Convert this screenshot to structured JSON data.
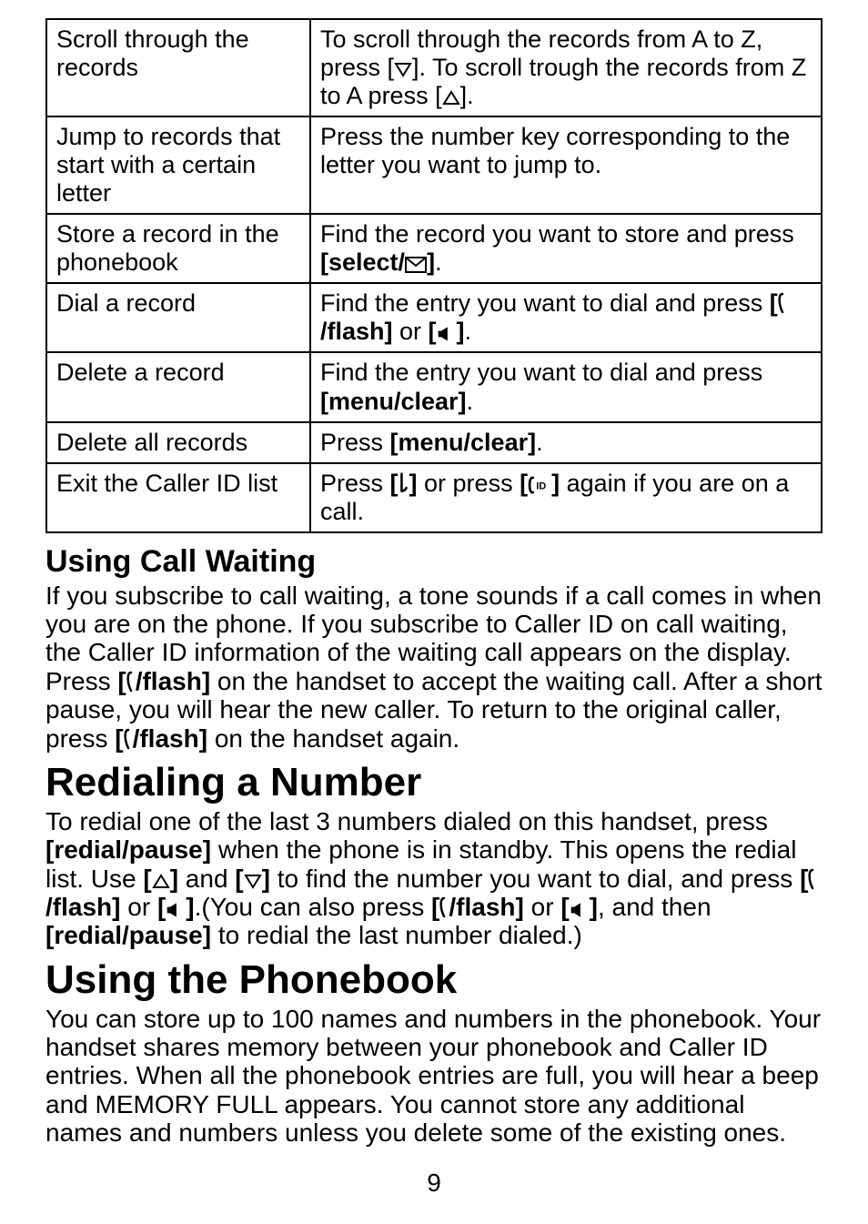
{
  "table": {
    "rows": [
      {
        "left": "Scroll through the records",
        "right_before_icon1": "To scroll through the records from A to Z, press [",
        "right_between": "]. To scroll trough the records from Z to A press [",
        "right_after": "]."
      },
      {
        "left": "Jump to records that start with a certain letter",
        "right": "Press the number key corresponding to the letter you want to jump to."
      },
      {
        "left": "Store a record in the phonebook",
        "right_before": "Find the record you want to store and press ",
        "right_bold_before_icon": "[select/",
        "right_bold_after_icon": "]",
        "right_after": "."
      },
      {
        "left": "Dial a record",
        "right_before": "Find the entry you want to dial and press ",
        "right_bold1_before": "[",
        "right_bold1_after": "/flash]",
        "right_mid": " or ",
        "right_bold2_before": "[",
        "right_bold2_after": "]",
        "right_after": "."
      },
      {
        "left": "Delete a record",
        "right_before": "Find the entry you want to dial and press ",
        "right_bold": "[menu/clear]",
        "right_after": "."
      },
      {
        "left": "Delete all records",
        "right_before": "Press ",
        "right_bold": "[menu/clear]",
        "right_after": "."
      },
      {
        "left": "Exit the Caller ID list",
        "right_before": "Press ",
        "right_bold1_before": "[",
        "right_bold1_after": "]",
        "right_mid": " or press ",
        "right_bold2_before": "[",
        "right_bold2_after": "]",
        "right_after": " again if you are on a call."
      }
    ]
  },
  "sections": {
    "call_waiting": {
      "heading": "Using Call Waiting",
      "p1a": "If you subscribe to call waiting, a tone sounds if a call comes in when you are on the phone. If you subscribe to Caller ID on call waiting, the Caller ID information of the waiting call appears on the display. Press ",
      "p1b_bold_before": "[",
      "p1b_bold_after": "/flash]",
      "p1c": " on the handset to accept the waiting call. After a short pause, you will hear the new caller. To return to the original caller, press ",
      "p1d_bold_before": "[",
      "p1d_bold_after": "/flash]",
      "p1e": " on the handset again."
    },
    "redial": {
      "heading": "Redialing a Number",
      "p1a": "To redial one of the last 3 numbers dialed on this handset, press ",
      "p1_bold1": "[redial/pause]",
      "p1b": " when the phone is in standby. This opens the redial list. Use ",
      "p1_bold2_before": "[",
      "p1_bold2_after": "]",
      "p1c": " and ",
      "p1_bold3_before": "[",
      "p1_bold3_after": "]",
      "p1d": " to find the number you want to dial, and press ",
      "p1_bold4_before": "[",
      "p1_bold4_after": "/flash]",
      "p1e": " or ",
      "p1_bold5_before": "[",
      "p1_bold5_after": "]",
      "p1f": ".(You can also press ",
      "p1_bold6_before": "[",
      "p1_bold6_after": "/flash]",
      "p1g": " or ",
      "p1_bold7_before": "[",
      "p1_bold7_after": "]",
      "p1h": ", and then ",
      "p1_bold8": "[redial/pause]",
      "p1i": " to redial the last number dialed.)"
    },
    "phonebook": {
      "heading": "Using the Phonebook",
      "p1": "You can store up to 100 names and numbers in the phonebook. Your handset shares memory between your phonebook and Caller ID entries. When all the phonebook entries are full, you will hear a beep and MEMORY FULL appears. You cannot store any additional names and numbers unless you delete some of the existing ones."
    }
  },
  "page_number": "9"
}
